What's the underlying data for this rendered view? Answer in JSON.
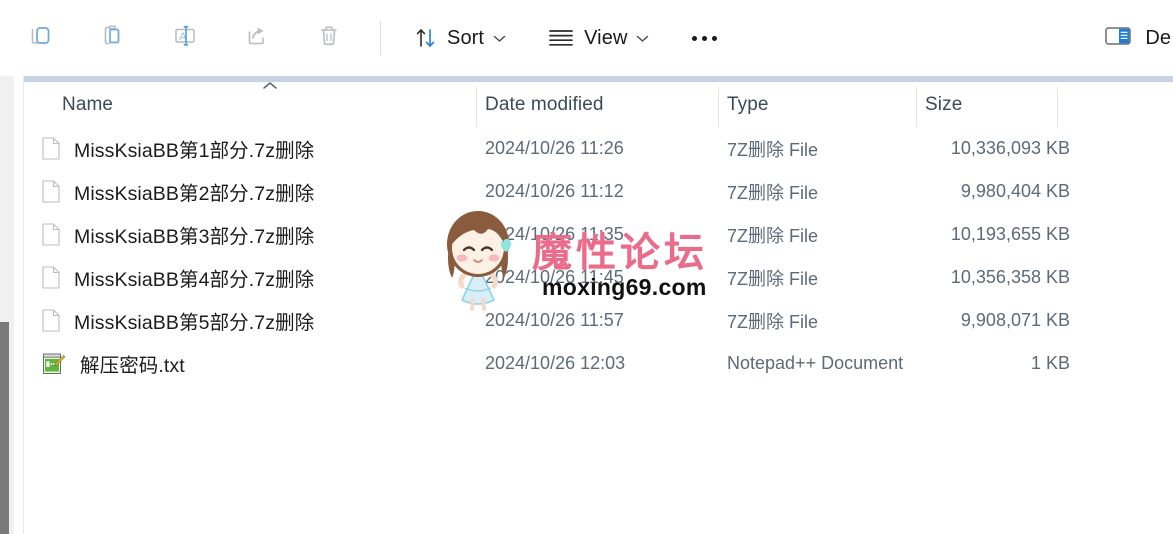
{
  "toolbar": {
    "icon_buttons": [
      {
        "name": "copy-icon",
        "label": "Copy"
      },
      {
        "name": "paste-icon",
        "label": "Paste"
      },
      {
        "name": "rename-icon",
        "label": "Rename"
      },
      {
        "name": "share-icon",
        "label": "Share"
      },
      {
        "name": "delete-icon",
        "label": "Delete"
      }
    ],
    "sort_label": "Sort",
    "view_label": "View",
    "more_label": "See more",
    "details_label": "De"
  },
  "columns": {
    "name": "Name",
    "date_modified": "Date modified",
    "type": "Type",
    "size": "Size",
    "sort_indicator": "ascending"
  },
  "files": [
    {
      "name": "MissKsiaBB第1部分.7z删除",
      "date": "2024/10/26 11:26",
      "type": "7Z删除 File",
      "size": "10,336,093 KB",
      "icon": "generic-file-icon"
    },
    {
      "name": "MissKsiaBB第2部分.7z删除",
      "date": "2024/10/26 11:12",
      "type": "7Z删除 File",
      "size": "9,980,404 KB",
      "icon": "generic-file-icon"
    },
    {
      "name": "MissKsiaBB第3部分.7z删除",
      "date": "2024/10/26 11:35",
      "type": "7Z删除 File",
      "size": "10,193,655 KB",
      "icon": "generic-file-icon"
    },
    {
      "name": "MissKsiaBB第4部分.7z删除",
      "date": "2024/10/26 11:45",
      "type": "7Z删除 File",
      "size": "10,356,358 KB",
      "icon": "generic-file-icon"
    },
    {
      "name": "MissKsiaBB第5部分.7z删除",
      "date": "2024/10/26 11:57",
      "type": "7Z删除 File",
      "size": "9,908,071 KB",
      "icon": "generic-file-icon"
    },
    {
      "name": "解压密码.txt",
      "date": "2024/10/26 12:03",
      "type": "Notepad++ Document",
      "size": "1 KB",
      "icon": "notepad-plus-plus-icon"
    }
  ],
  "watermark": {
    "forum_name": "魔性论坛",
    "url": "moxing69.com",
    "forum_color": "#ea6b8a",
    "url_color": "#111111"
  },
  "colors": {
    "accent_blue": "#0f6cbd",
    "header_band": "#c6d3e3",
    "header_text": "#3b4a5a",
    "secondary_text": "#5d6a78",
    "rail_bg": "#f0f0f0",
    "scroll_thumb": "#7a7a7a"
  }
}
